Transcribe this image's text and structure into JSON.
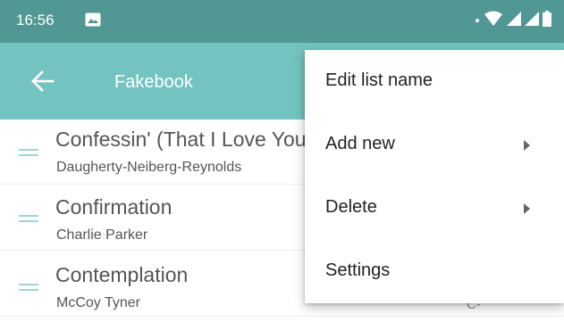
{
  "status_bar": {
    "time": "16:56",
    "icons": [
      "image-icon",
      "small-dot-icon",
      "wifi-icon",
      "signal-icon",
      "signal-icon",
      "battery-icon"
    ]
  },
  "app_bar": {
    "title": "Fakebook",
    "back_icon": "arrow-left-icon"
  },
  "list": {
    "items": [
      {
        "title": "Confessin' (That I Love You)",
        "subtitle": "Daugherty-Neiberg-Reynolds",
        "key": ""
      },
      {
        "title": "Confirmation",
        "subtitle": "Charlie Parker",
        "key": ""
      },
      {
        "title": "Contemplation",
        "subtitle": "McCoy Tyner",
        "key": "C-"
      }
    ]
  },
  "menu": {
    "items": [
      {
        "label": "Edit list name",
        "has_submenu": false
      },
      {
        "label": "Add new",
        "has_submenu": true
      },
      {
        "label": "Delete",
        "has_submenu": true
      },
      {
        "label": "Settings",
        "has_submenu": false
      }
    ]
  },
  "colors": {
    "status_bar": "#519793",
    "app_bar": "#73c4c0",
    "drag_handle": "#9fd4d1"
  }
}
